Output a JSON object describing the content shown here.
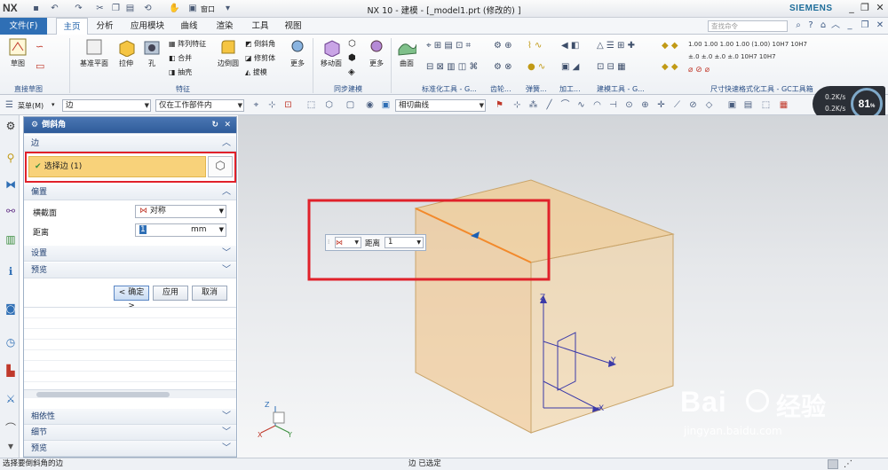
{
  "titlebar": {
    "logo": "NX",
    "title": "NX 10 - 建模 - [_model1.prt  (修改的) ]",
    "brand": "SIEMENS",
    "window_menu": "窗口"
  },
  "menu": {
    "tabs": [
      "文件(F)",
      "主页",
      "分析",
      "应用模块",
      "曲线",
      "渲染",
      "工具",
      "视图"
    ],
    "search_placeholder": "查找命令"
  },
  "ribbon": {
    "groups": [
      {
        "label": "直接草图",
        "buttons": [
          "草图"
        ]
      },
      {
        "label": "特征",
        "buttons": [
          "基准平面",
          "拉伸",
          "孔",
          "阵列特征",
          "合并",
          "抽壳",
          "边倒圆",
          "倒斜角",
          "修剪体",
          "拔模",
          "更多"
        ]
      },
      {
        "label": "同步建模",
        "buttons": [
          "移动面",
          "更多"
        ]
      },
      {
        "label": "标准化工具 - G...",
        "buttons": [
          "曲面"
        ]
      },
      {
        "label": "齿轮...",
        "buttons": []
      },
      {
        "label": "弹簧...",
        "buttons": []
      },
      {
        "label": "加工...",
        "buttons": []
      },
      {
        "label": "建模工具 - G...",
        "buttons": []
      },
      {
        "label": "尺寸快速格式化工具 - GC工具箱",
        "buttons": []
      }
    ]
  },
  "toolbar2": {
    "menu_label": "菜单(M)",
    "filter_type": "边",
    "filter_scope": "仅在工作部件内",
    "curve_rule": "相切曲线"
  },
  "gauge": {
    "percent": "81",
    "unit": "%",
    "up": "0.2K/s",
    "down": "0.2K/s"
  },
  "panel": {
    "title": "倒斜角",
    "edge_section": "边",
    "select_edge": "选择边 (1)",
    "offset_section": "偏置",
    "cross_section_label": "横截面",
    "cross_section_value": "对称",
    "distance_label": "距离",
    "distance_value": "1",
    "distance_unit": "mm",
    "settings_section": "设置",
    "preview_section": "预览",
    "ok": "< 确定 >",
    "apply": "应用",
    "cancel": "取消",
    "bottom_sections": [
      "相依性",
      "细节",
      "预览"
    ]
  },
  "float_toolbar": {
    "distance_label": "距离",
    "distance_value": "1"
  },
  "axes": {
    "z": "Z",
    "y": "Y",
    "x": "X",
    "sz": "Z",
    "sy": "Y",
    "sx": "X"
  },
  "status": {
    "left": "选择要倒斜角的边",
    "center": "边 已选定"
  },
  "watermark": {
    "line1": "Bai",
    "line2": "经验",
    "url": "jingyan.baidu.com"
  }
}
